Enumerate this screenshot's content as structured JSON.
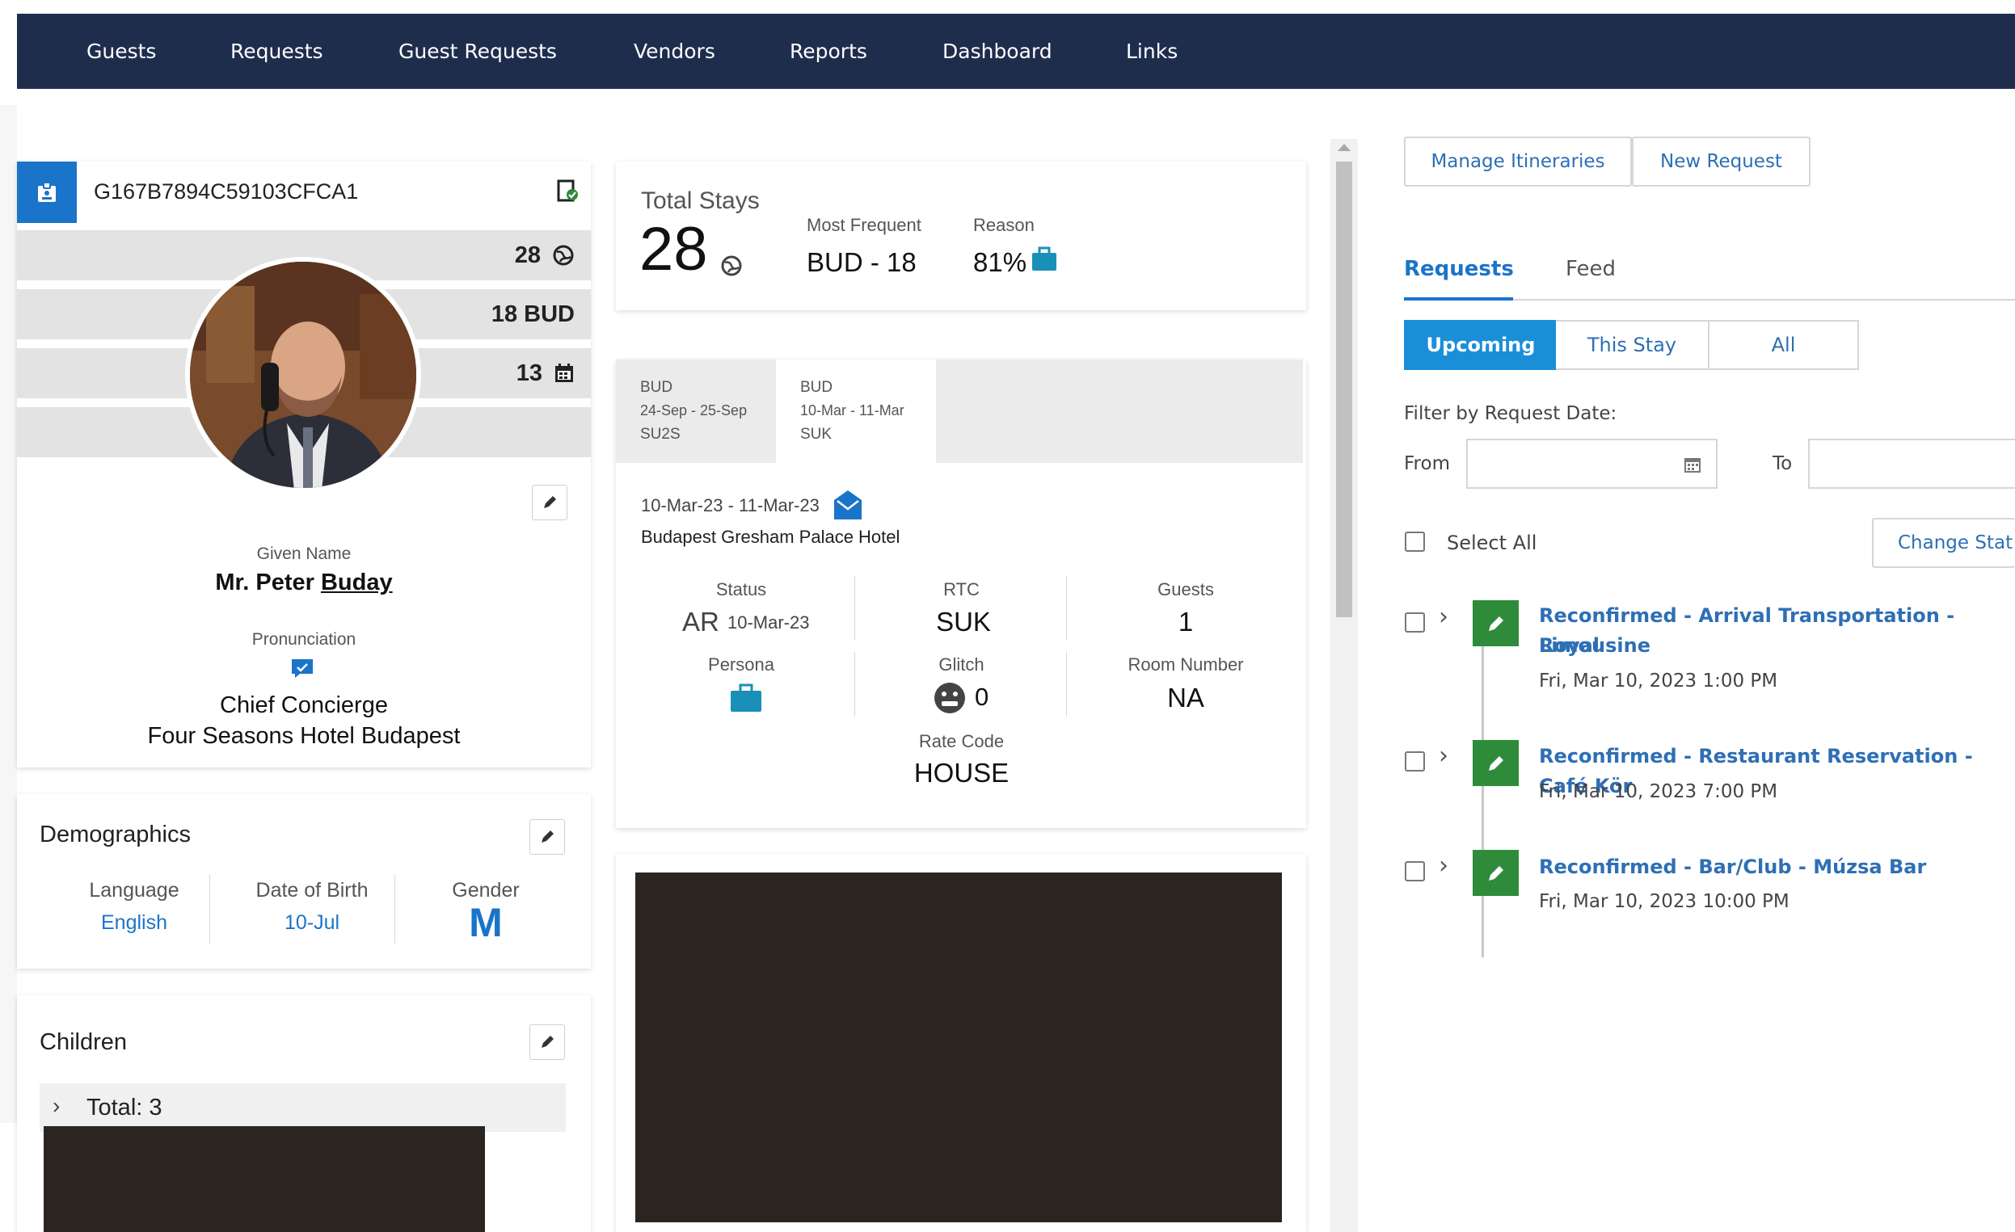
{
  "nav": {
    "items": [
      "Guests",
      "Requests",
      "Guest Requests",
      "Vendors",
      "Reports",
      "Dashboard",
      "Links"
    ]
  },
  "profile": {
    "guest_id": "G167B7894C59103CFCA1",
    "bands": [
      {
        "value": "28",
        "icon": "globe-icon"
      },
      {
        "value": "18 BUD",
        "icon": ""
      },
      {
        "value": "13",
        "icon": "calendar-icon"
      }
    ],
    "given_name_label": "Given Name",
    "name_prefix": "Mr. Peter ",
    "name_last": "Buday",
    "pronunciation_label": "Pronunciation",
    "title": "Chief Concierge",
    "company": "Four Seasons Hotel Budapest"
  },
  "demographics": {
    "heading": "Demographics",
    "language_label": "Language",
    "language_value": "English",
    "dob_label": "Date of Birth",
    "dob_value": "10-Jul",
    "gender_label": "Gender",
    "gender_value": "M"
  },
  "children": {
    "heading": "Children",
    "total": "Total: 3"
  },
  "stats": {
    "total_label": "Total Stays",
    "total_value": "28",
    "frequent_label": "Most Frequent",
    "frequent_value": "BUD - 18",
    "reason_label": "Reason",
    "reason_value": "81%"
  },
  "stay": {
    "tabs": [
      {
        "code": "BUD",
        "dates": "24-Sep - 25-Sep",
        "room": "SU2S"
      },
      {
        "code": "BUD",
        "dates": "10-Mar - 11-Mar",
        "room": "SUK"
      }
    ],
    "date_range": "10-Mar-23 - 11-Mar-23",
    "hotel": "Budapest Gresham Palace Hotel",
    "status_label": "Status",
    "status_code": "AR",
    "status_date": "10-Mar-23",
    "rtc_label": "RTC",
    "rtc_value": "SUK",
    "guests_label": "Guests",
    "guests_value": "1",
    "persona_label": "Persona",
    "glitch_label": "Glitch",
    "glitch_value": "0",
    "room_label": "Room Number",
    "room_value": "NA",
    "rate_label": "Rate Code",
    "rate_value": "HOUSE"
  },
  "right": {
    "manage_btn": "Manage Itineraries",
    "new_btn": "New Request",
    "tabs": [
      "Requests",
      "Feed"
    ],
    "segments": [
      "Upcoming",
      "This Stay",
      "All"
    ],
    "filter_label": "Filter by Request Date:",
    "from_label": "From",
    "to_label": "To",
    "select_all": "Select All",
    "change_status_btn": "Change Stat",
    "requests": [
      {
        "title_line1": "Reconfirmed - Arrival Transportation - Royal",
        "title_line2": "Limousine",
        "date": "Fri, Mar 10, 2023 1:00 PM"
      },
      {
        "title_line1": "Reconfirmed - Restaurant Reservation - Café Kör",
        "title_line2": "",
        "date": "Fri, Mar 10, 2023 7:00 PM"
      },
      {
        "title_line1": "Reconfirmed - Bar/Club - Múzsa Bar",
        "title_line2": "",
        "date": "Fri, Mar 10, 2023 10:00 PM"
      }
    ]
  },
  "colors": {
    "navbar": "#1f2d4d",
    "accent_blue": "#1a74c9",
    "link_blue": "#2e6fb5",
    "green": "#2e8b3a"
  }
}
